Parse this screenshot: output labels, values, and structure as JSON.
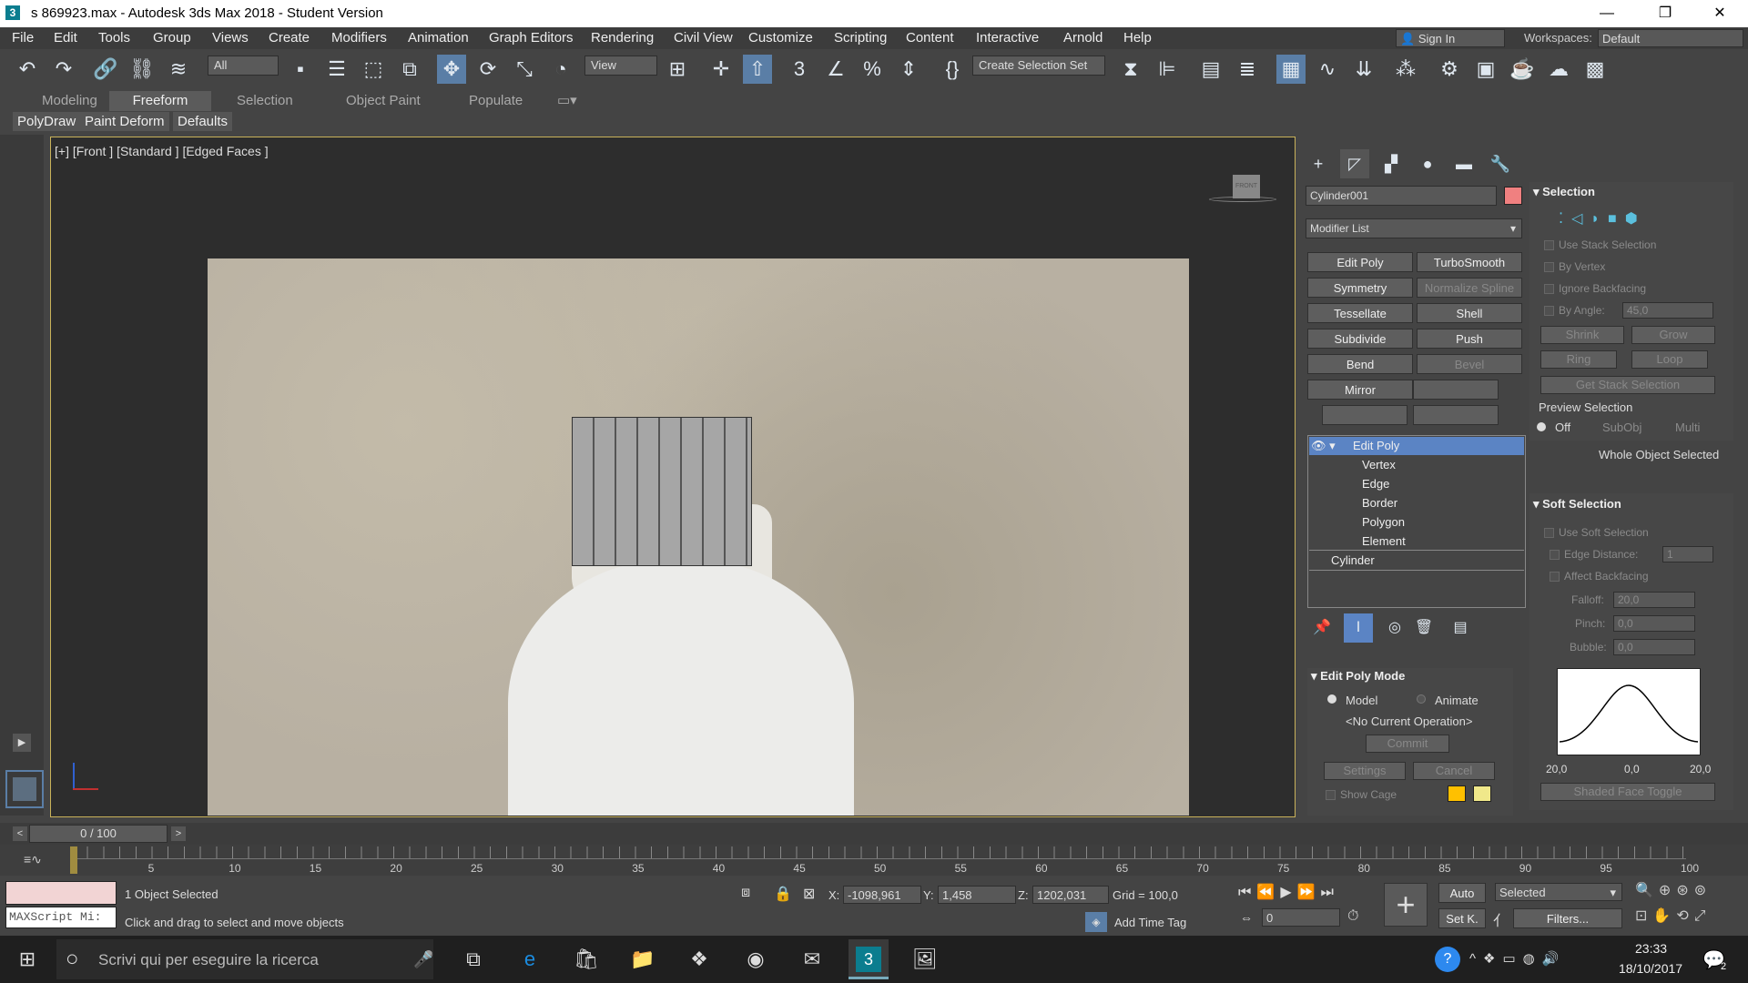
{
  "window": {
    "title": "s 869923.max - Autodesk 3ds Max 2018 - Student Version",
    "minimize": "—",
    "maximize": "❐",
    "close": "✕"
  },
  "menu": [
    "File",
    "Edit",
    "Tools",
    "Group",
    "Views",
    "Create",
    "Modifiers",
    "Animation",
    "Graph Editors",
    "Rendering",
    "Civil View",
    "Customize",
    "Scripting",
    "Content",
    "Interactive",
    "Arnold",
    "Help"
  ],
  "account": {
    "signin": "Sign In",
    "workspaces_label": "Workspaces:",
    "workspace": "Default"
  },
  "toolbar": {
    "filter": "All",
    "refcoord": "View",
    "selset": "Create Selection Set"
  },
  "ribbon": {
    "tabs": [
      "Modeling",
      "Freeform",
      "Selection",
      "Object Paint",
      "Populate"
    ],
    "active": "Freeform",
    "subtabs": [
      "PolyDraw",
      "Paint Deform",
      "Defaults"
    ]
  },
  "viewport": {
    "label": "[+] [Front ] [Standard ] [Edged Faces ]",
    "viewcube": "FRONT"
  },
  "command_panel": {
    "object_name": "Cylinder001",
    "object_color": "#f08080",
    "modifier_list": "Modifier List",
    "modifier_buttons": [
      "Edit Poly",
      "TurboSmooth",
      "Symmetry",
      "Normalize Spline",
      "Tessellate",
      "Shell",
      "Subdivide",
      "Push",
      "Bend",
      "Bevel",
      "Mirror"
    ],
    "stack": {
      "top": "Edit Poly",
      "subs": [
        "Vertex",
        "Edge",
        "Border",
        "Polygon",
        "Element"
      ],
      "base": "Cylinder"
    },
    "edit_poly_mode": {
      "title": "Edit Poly Mode",
      "model": "Model",
      "animate": "Animate",
      "operation": "<No Current Operation>",
      "commit": "Commit",
      "settings": "Settings",
      "cancel": "Cancel",
      "show_cage": "Show Cage"
    }
  },
  "selection_panel": {
    "title": "Selection",
    "use_stack": "Use Stack Selection",
    "by_vertex": "By Vertex",
    "ignore_backfacing": "Ignore Backfacing",
    "by_angle": "By Angle:",
    "angle_value": "45,0",
    "shrink": "Shrink",
    "grow": "Grow",
    "ring": "Ring",
    "loop": "Loop",
    "get_stack": "Get Stack Selection",
    "preview": "Preview Selection",
    "off": "Off",
    "subobj": "SubObj",
    "multi": "Multi",
    "status": "Whole Object Selected"
  },
  "soft_selection": {
    "title": "Soft Selection",
    "use_soft": "Use Soft Selection",
    "edge_distance": "Edge Distance:",
    "edge_value": "1",
    "affect_backfacing": "Affect Backfacing",
    "falloff": "Falloff:",
    "falloff_value": "20,0",
    "pinch": "Pinch:",
    "pinch_value": "0,0",
    "bubble": "Bubble:",
    "bubble_value": "0,0",
    "curve_left": "20,0",
    "curve_mid": "0,0",
    "curve_right": "20,0",
    "shaded_toggle": "Shaded Face Toggle"
  },
  "time": {
    "frame": "0 / 100",
    "ticks": [
      "5",
      "10",
      "15",
      "20",
      "25",
      "30",
      "35",
      "40",
      "45",
      "50",
      "55",
      "60",
      "65",
      "70",
      "75",
      "80",
      "85",
      "90",
      "95",
      "100"
    ]
  },
  "status": {
    "maxscript": "MAXScript Mi:",
    "selected": "1 Object Selected",
    "prompt": "Click and drag to select and move objects",
    "x_label": "X:",
    "x": "-1098,961",
    "y_label": "Y:",
    "y": "1,458",
    "z_label": "Z:",
    "z": "1202,031",
    "grid": "Grid = 100,0",
    "add_time_tag": "Add Time Tag",
    "auto": "Auto",
    "setk": "Set K.",
    "selected_dd": "Selected",
    "filters": "Filters...",
    "frame_field": "0"
  },
  "taskbar": {
    "search": "Scrivi qui per eseguire la ricerca",
    "time": "23:33",
    "date": "18/10/2017",
    "notif": "2"
  }
}
